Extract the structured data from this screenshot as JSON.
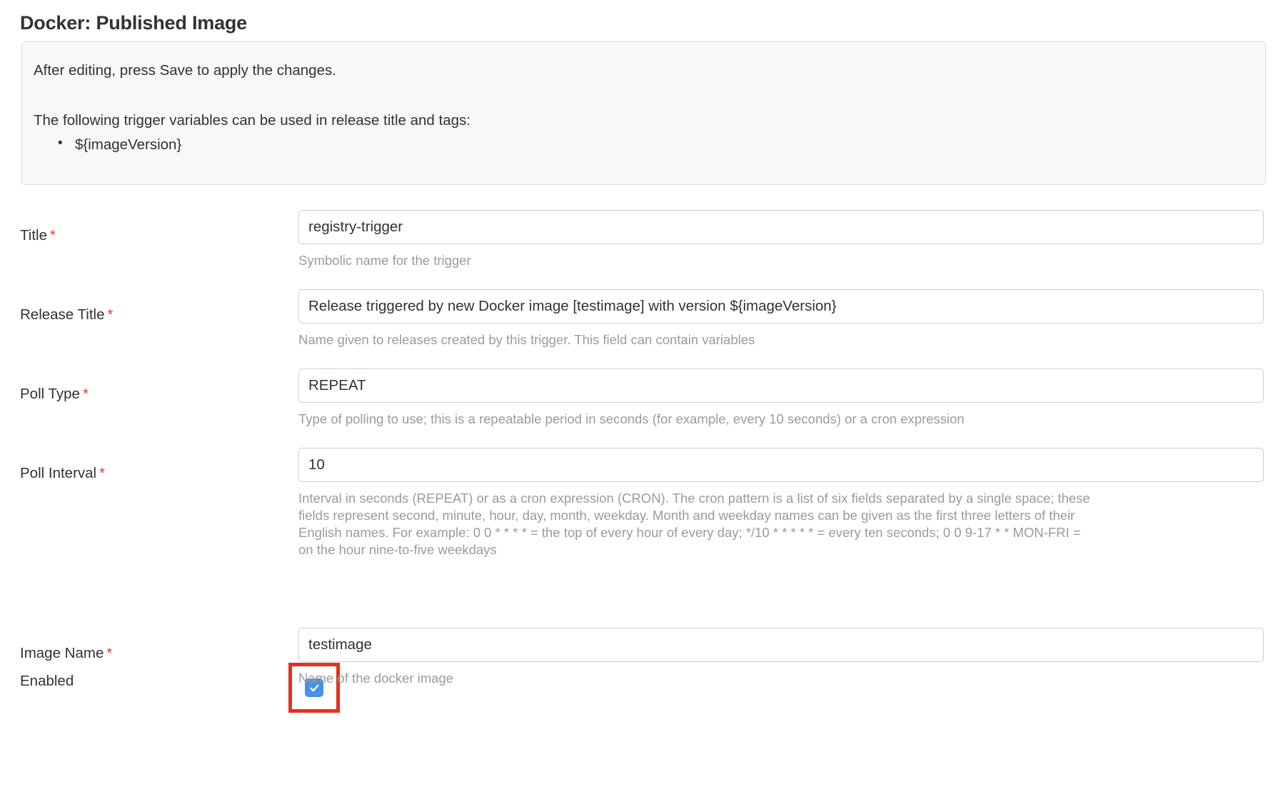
{
  "page": {
    "title": "Docker: Published Image"
  },
  "info_panel": {
    "line1": "After editing, press Save to apply the changes.",
    "line2": "The following trigger variables can be used in release title and tags:",
    "variables": [
      "${imageVersion}"
    ]
  },
  "fields": {
    "title": {
      "label": "Title",
      "required_marker": "*",
      "value": "registry-trigger",
      "help": "Symbolic name for the trigger"
    },
    "release_title": {
      "label": "Release Title",
      "required_marker": "*",
      "value": "Release triggered by new Docker image [testimage] with version ${imageVersion}",
      "help": "Name given to releases created by this trigger. This field can contain variables"
    },
    "poll_type": {
      "label": "Poll Type",
      "required_marker": "*",
      "value": "REPEAT",
      "help": "Type of polling to use; this is a repeatable period in seconds (for example, every 10 seconds) or a cron expression"
    },
    "poll_interval": {
      "label": "Poll Interval",
      "required_marker": "*",
      "value": "10",
      "help": "Interval in seconds (REPEAT) or as a cron expression (CRON). The cron pattern is a list of six fields separated by a single space; these fields represent second, minute, hour, day, month, weekday. Month and weekday names can be given as the first three letters of their English names. For example: 0 0 * * * * = the top of every hour of every day; */10 * * * * * = every ten seconds; 0 0 9-17 * * MON-FRI = on the hour nine-to-five weekdays"
    },
    "enabled": {
      "label": "Enabled",
      "checked": true,
      "checkbox_color": "#4a90e8",
      "highlight_color": "#e8301c"
    },
    "image_name": {
      "label": "Image Name",
      "required_marker": "*",
      "value": "testimage",
      "help": "Name of the docker image"
    }
  }
}
